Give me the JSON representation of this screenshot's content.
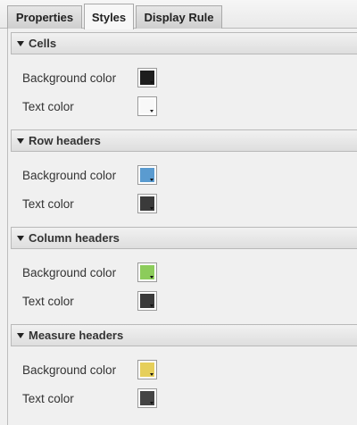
{
  "tabs": [
    {
      "label": "Properties",
      "active": false
    },
    {
      "label": "Styles",
      "active": true
    },
    {
      "label": "Display Rule",
      "active": false
    }
  ],
  "sections": [
    {
      "title": "Cells",
      "rows": [
        {
          "label": "Background color",
          "color": "#1e1e1e"
        },
        {
          "label": "Text color",
          "color": "#f8f8f8"
        }
      ]
    },
    {
      "title": "Row headers",
      "rows": [
        {
          "label": "Background color",
          "color": "#5a9bd0"
        },
        {
          "label": "Text color",
          "color": "#3a3a3a"
        }
      ]
    },
    {
      "title": "Column headers",
      "rows": [
        {
          "label": "Background color",
          "color": "#8ccc5b"
        },
        {
          "label": "Text color",
          "color": "#3a3a3a"
        }
      ]
    },
    {
      "title": "Measure headers",
      "rows": [
        {
          "label": "Background color",
          "color": "#e6cf5a"
        },
        {
          "label": "Text color",
          "color": "#444444"
        }
      ]
    }
  ]
}
